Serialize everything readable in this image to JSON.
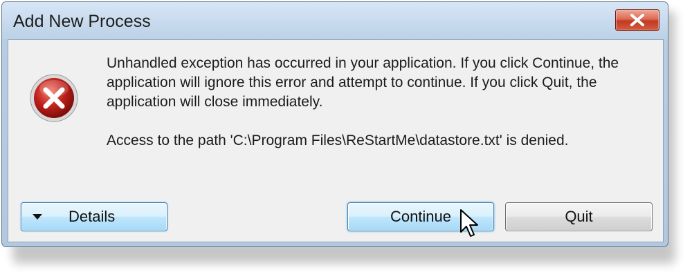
{
  "window": {
    "title": "Add New Process"
  },
  "icons": {
    "close": "close-icon",
    "error": "error-icon",
    "dropdown": "dropdown-arrow-icon",
    "cursor": "mouse-pointer-icon"
  },
  "message": {
    "body": "Unhandled exception has occurred in your application. If you click Continue, the application will ignore this error and attempt to continue. If you click Quit, the application will close immediately.",
    "detail": "Access to the path 'C:\\Program Files\\ReStartMe\\datastore.txt' is denied."
  },
  "buttons": {
    "details": "Details",
    "continue": "Continue",
    "quit": "Quit"
  },
  "colors": {
    "error_red": "#c0211c",
    "close_red": "#c33a22",
    "focus_blue": "#3c7fb1"
  }
}
